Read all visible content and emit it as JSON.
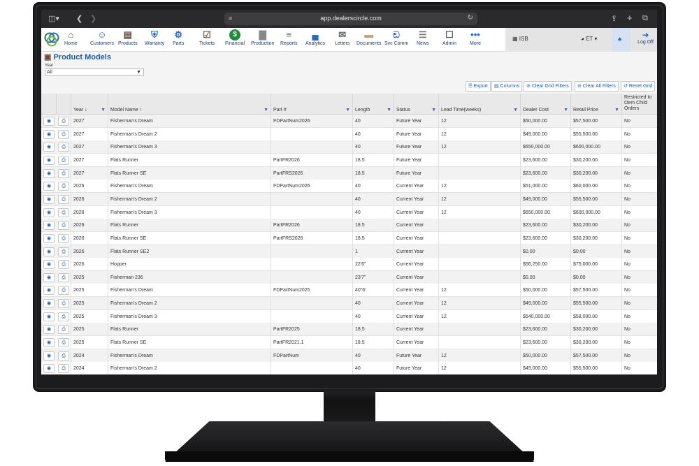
{
  "browser": {
    "url": "app.dealerscircle.com"
  },
  "nav": {
    "items": [
      {
        "label": "Home",
        "icon": "home-icon",
        "color": "#555555"
      },
      {
        "label": "Customers",
        "icon": "customers-icon",
        "color": "#2a6ac0"
      },
      {
        "label": "Products",
        "icon": "products-icon",
        "color": "#6b4a3a"
      },
      {
        "label": "Warranty",
        "icon": "warranty-shield-icon",
        "color": "#2a6ac0"
      },
      {
        "label": "Parts",
        "icon": "parts-gear-icon",
        "color": "#2a6ac0"
      },
      {
        "label": "Tickets",
        "icon": "tickets-clipboard-icon",
        "color": "#7a5a4a"
      },
      {
        "label": "Financial",
        "icon": "financial-dollar-icon",
        "color": "#1e8a3a"
      },
      {
        "label": "Production",
        "icon": "production-chart-icon",
        "color": "#888888"
      },
      {
        "label": "Reports",
        "icon": "reports-icon",
        "color": "#777777"
      },
      {
        "label": "Analytics",
        "icon": "analytics-icon",
        "color": "#2a6ac0"
      },
      {
        "label": "Letters",
        "icon": "letters-envelope-icon",
        "color": "#666666"
      },
      {
        "label": "Documents",
        "icon": "documents-folder-icon",
        "color": "#c9a07a"
      },
      {
        "label": "Svc Comm",
        "icon": "svc-comm-antenna-icon",
        "color": "#2a6ac0"
      },
      {
        "label": "News",
        "icon": "news-icon",
        "color": "#777777"
      },
      {
        "label": "Admin",
        "icon": "admin-lock-icon",
        "color": "#555555"
      },
      {
        "label": "More",
        "icon": "more-dots-icon",
        "color": "#2a6ac0"
      }
    ],
    "location": "ISB",
    "timezone": "ET",
    "logoff_label": "Log Off"
  },
  "page": {
    "title": "Product Models",
    "year_label": "Year",
    "year_value": "All"
  },
  "toolbar": {
    "export": "Export",
    "columns": "Columns",
    "clear_grid": "Clear Grid Filters",
    "clear_all": "Clear All Filters",
    "reset": "Reset Grid"
  },
  "grid": {
    "headers": {
      "year": "Year ↓",
      "model": "Model Name ↑",
      "part": "Part #",
      "length": "Length",
      "status": "Status",
      "lead": "Lead Time(weeks)",
      "dealer": "Dealer Cost",
      "retail": "Retail Price",
      "restricted": "Restricted to Oem Child Orders"
    },
    "rows": [
      {
        "year": "2027",
        "model": "Fisherman's Dream",
        "part": "FDPartNum2026",
        "length": "40",
        "status": "Future Year",
        "lead": "12",
        "dealer": "$50,000.00",
        "retail": "$57,500.00",
        "restricted": "No"
      },
      {
        "year": "2027",
        "model": "Fisherman's Dream 2",
        "part": "",
        "length": "40",
        "status": "Future Year",
        "lead": "12",
        "dealer": "$49,000.00",
        "retail": "$55,500.00",
        "restricted": "No"
      },
      {
        "year": "2027",
        "model": "Fisherman's Dream 3",
        "part": "",
        "length": "40",
        "status": "Future Year",
        "lead": "12",
        "dealer": "$650,000.00",
        "retail": "$600,000.00",
        "restricted": "No"
      },
      {
        "year": "2027",
        "model": "Flats Runner",
        "part": "PartFR2026",
        "length": "18.5",
        "status": "Future Year",
        "lead": "",
        "dealer": "$23,600.00",
        "retail": "$30,200.00",
        "restricted": "No"
      },
      {
        "year": "2027",
        "model": "Flats Runner SE",
        "part": "PartFRS2026",
        "length": "18.5",
        "status": "Future Year",
        "lead": "",
        "dealer": "$23,600.00",
        "retail": "$30,200.00",
        "restricted": "No"
      },
      {
        "year": "2026",
        "model": "Fisherman's Dream",
        "part": "FDPartNum2026",
        "length": "40",
        "status": "Current Year",
        "lead": "12",
        "dealer": "$51,000.00",
        "retail": "$60,000.00",
        "restricted": "No"
      },
      {
        "year": "2026",
        "model": "Fisherman's Dream 2",
        "part": "",
        "length": "40",
        "status": "Current Year",
        "lead": "12",
        "dealer": "$49,000.00",
        "retail": "$55,500.00",
        "restricted": "No"
      },
      {
        "year": "2026",
        "model": "Fisherman's Dream 3",
        "part": "",
        "length": "40",
        "status": "Current Year",
        "lead": "12",
        "dealer": "$650,000.00",
        "retail": "$600,000.00",
        "restricted": "No"
      },
      {
        "year": "2026",
        "model": "Flats Runner",
        "part": "PartFR2026",
        "length": "18.5",
        "status": "Current Year",
        "lead": "",
        "dealer": "$23,600.00",
        "retail": "$30,200.00",
        "restricted": "No"
      },
      {
        "year": "2026",
        "model": "Flats Runner SE",
        "part": "PartFRS2026",
        "length": "18.5",
        "status": "Current Year",
        "lead": "",
        "dealer": "$23,600.00",
        "retail": "$30,200.00",
        "restricted": "No"
      },
      {
        "year": "2026",
        "model": "Flats Runner SE2",
        "part": "",
        "length": "1",
        "status": "Current Year",
        "lead": "",
        "dealer": "$0.00",
        "retail": "$0.00",
        "restricted": "No"
      },
      {
        "year": "2026",
        "model": "Hopper",
        "part": "",
        "length": "22'6\"",
        "status": "Current Year",
        "lead": "",
        "dealer": "$56,250.00",
        "retail": "$75,000.00",
        "restricted": "No"
      },
      {
        "year": "2025",
        "model": "Fisherman 236",
        "part": "",
        "length": "23'7\"",
        "status": "Current Year",
        "lead": "",
        "dealer": "$0.00",
        "retail": "$0.00",
        "restricted": "No"
      },
      {
        "year": "2025",
        "model": "Fisherman's Dream",
        "part": "FDPartNum2025",
        "length": "40\"6'",
        "status": "Current Year",
        "lead": "12",
        "dealer": "$50,000.00",
        "retail": "$57,500.00",
        "restricted": "No"
      },
      {
        "year": "2025",
        "model": "Fisherman's Dream 2",
        "part": "",
        "length": "40",
        "status": "Current Year",
        "lead": "12",
        "dealer": "$49,000.00",
        "retail": "$55,500.00",
        "restricted": "No"
      },
      {
        "year": "2025",
        "model": "Fisherman's Dream 3",
        "part": "",
        "length": "40",
        "status": "Current Year",
        "lead": "12",
        "dealer": "$540,000.00",
        "retail": "$58,000.00",
        "restricted": "No"
      },
      {
        "year": "2025",
        "model": "Flats Runner",
        "part": "PartFR2025",
        "length": "18.5",
        "status": "Current Year",
        "lead": "",
        "dealer": "$23,600.00",
        "retail": "$30,200.00",
        "restricted": "No"
      },
      {
        "year": "2025",
        "model": "Flats Runner SE",
        "part": "PartFR2021.1",
        "length": "18.5",
        "status": "Current Year",
        "lead": "",
        "dealer": "$23,600.00",
        "retail": "$30,200.00",
        "restricted": "No"
      },
      {
        "year": "2024",
        "model": "Fisherman's Dream",
        "part": "FDPartNum",
        "length": "40",
        "status": "Future Year",
        "lead": "12",
        "dealer": "$50,000.00",
        "retail": "$57,500.00",
        "restricted": "No"
      },
      {
        "year": "2024",
        "model": "Fisherman's Dream 2",
        "part": "",
        "length": "40",
        "status": "Future Year",
        "lead": "12",
        "dealer": "$49,000.00",
        "retail": "$55,500.00",
        "restricted": "No"
      }
    ]
  }
}
